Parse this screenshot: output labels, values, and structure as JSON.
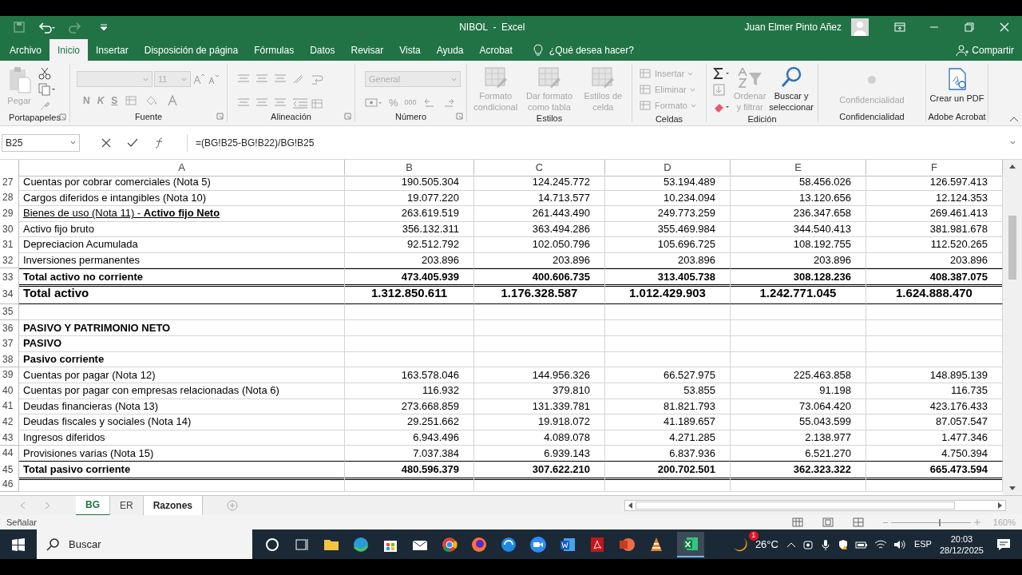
{
  "title_bar": {
    "title": "NIBOL  -  Excel",
    "user": "Juan Elmer Pinto Añez"
  },
  "tabs": [
    {
      "label": "Archivo",
      "selected": false
    },
    {
      "label": "Inicio",
      "selected": true
    },
    {
      "label": "Insertar",
      "selected": false
    },
    {
      "label": "Disposición de página",
      "selected": false
    },
    {
      "label": "Fórmulas",
      "selected": false
    },
    {
      "label": "Datos",
      "selected": false
    },
    {
      "label": "Revisar",
      "selected": false
    },
    {
      "label": "Vista",
      "selected": false
    },
    {
      "label": "Ayuda",
      "selected": false
    },
    {
      "label": "Acrobat",
      "selected": false
    }
  ],
  "tell_me": "¿Qué desea hacer?",
  "share": "Compartir",
  "ribbon": [
    {
      "kind": "clipboard",
      "label": "Portapapeles",
      "launcher": true,
      "items": [
        {
          "label": "Pegar",
          "disabled": true
        }
      ]
    },
    {
      "kind": "font",
      "label": "Fuente",
      "launcher": true,
      "size": "11",
      "items": [
        {
          "label": "N",
          "disabled": true
        },
        {
          "label": "K",
          "disabled": true
        },
        {
          "label": "S",
          "disabled": true
        }
      ]
    },
    {
      "kind": "alignment",
      "label": "Alineación",
      "launcher": true
    },
    {
      "kind": "number",
      "label": "Número",
      "launcher": true,
      "format": "General",
      "items": [
        {
          "label": "%",
          "disabled": true
        },
        {
          "label": "000",
          "disabled": true
        }
      ]
    },
    {
      "kind": "styles",
      "label": "Estilos",
      "launcher": false,
      "items": [
        {
          "label": "Formato condicional",
          "disabled": true
        },
        {
          "label": "Dar formato como tabla",
          "disabled": true
        },
        {
          "label": "Estilos de celda",
          "disabled": true
        }
      ]
    },
    {
      "kind": "cells",
      "label": "Celdas",
      "launcher": false,
      "items": [
        {
          "label": "Insertar",
          "disabled": true
        },
        {
          "label": "Eliminar",
          "disabled": true
        },
        {
          "label": "Formato",
          "disabled": true
        }
      ]
    },
    {
      "kind": "editing",
      "label": "Edición",
      "launcher": false,
      "items": [
        {
          "label": "Ordenar y filtrar",
          "disabled": true
        },
        {
          "label": "Buscar y seleccionar",
          "disabled": false
        }
      ]
    },
    {
      "kind": "sensitivity",
      "label": "Confidencialidad",
      "launcher": false,
      "items": [
        {
          "label": "Confidencialidad",
          "disabled": true
        }
      ]
    },
    {
      "kind": "acrobat",
      "label": "Adobe Acrobat",
      "launcher": false,
      "items": [
        {
          "label": "Crear un PDF",
          "disabled": false
        }
      ]
    }
  ],
  "formula_bar": {
    "name_box": "B25",
    "formula": "=(BG!B25-BG!B22)/BG!B25"
  },
  "columns": [
    "A",
    "B",
    "C",
    "D",
    "E",
    "F"
  ],
  "rows": [
    {
      "n": "27",
      "kind": "data",
      "cells": [
        "Cuentas por cobrar comerciales (Nota 5)",
        "190.505.304",
        "124.245.772",
        "53.194.489",
        "58.456.026",
        "126.597.413"
      ]
    },
    {
      "n": "28",
      "kind": "data",
      "cells": [
        "Cargos diferidos e intangibles (Nota 10)",
        "19.077.220",
        "14.713.577",
        "10.234.094",
        "13.120.656",
        "12.124.353"
      ]
    },
    {
      "n": "29",
      "kind": "data",
      "underline": true,
      "cells": [
        "Bienes de uso (Nota 11) - **Activo fijo Neto**",
        "263.619.519",
        "261.443.490",
        "249.773.259",
        "236.347.658",
        "269.461.413"
      ]
    },
    {
      "n": "30",
      "kind": "data",
      "cells": [
        "Activo fijo bruto",
        "356.132.311",
        "363.494.286",
        "355.469.984",
        "344.540.413",
        "381.981.678"
      ]
    },
    {
      "n": "31",
      "kind": "data",
      "cells": [
        "Depreciacion Acumulada",
        "92.512.792",
        "102.050.796",
        "105.696.725",
        "108.192.755",
        "112.520.265"
      ]
    },
    {
      "n": "32",
      "kind": "data",
      "cells": [
        "Inversiones permanentes",
        "203.896",
        "203.896",
        "203.896",
        "203.896",
        "203.896"
      ]
    },
    {
      "n": "33",
      "kind": "total",
      "cells": [
        "Total activo no corriente",
        "473.405.939",
        "400.606.735",
        "313.405.738",
        "308.128.236",
        "408.387.075"
      ]
    },
    {
      "n": "34",
      "kind": "grand",
      "cells": [
        "Total activo",
        "1.312.850.611",
        "1.176.328.587",
        "1.012.429.903",
        "1.242.771.045",
        "1.624.888.470"
      ]
    },
    {
      "n": "35",
      "kind": "empty",
      "cells": []
    },
    {
      "n": "36",
      "kind": "heading",
      "cells": [
        "PASIVO Y PATRIMONIO NETO"
      ]
    },
    {
      "n": "37",
      "kind": "heading",
      "cells": [
        "PASIVO"
      ]
    },
    {
      "n": "38",
      "kind": "heading",
      "cells": [
        "Pasivo corriente"
      ]
    },
    {
      "n": "39",
      "kind": "data",
      "cells": [
        "Cuentas por pagar (Nota 12)",
        "163.578.046",
        "144.956.326",
        "66.527.975",
        "225.463.858",
        "148.895.139"
      ]
    },
    {
      "n": "40",
      "kind": "data",
      "cells": [
        "Cuentas por pagar con empresas relacionadas (Nota 6)",
        "116.932",
        "379.810",
        "53.855",
        "91.198",
        "116.735"
      ]
    },
    {
      "n": "41",
      "kind": "data",
      "cells": [
        "Deudas financieras (Nota 13)",
        "273.668.859",
        "131.339.781",
        "81.821.793",
        "73.064.420",
        "423.176.433"
      ]
    },
    {
      "n": "42",
      "kind": "data",
      "cells": [
        "Deudas fiscales y sociales (Nota 14)",
        "29.251.662",
        "19.918.072",
        "41.189.657",
        "55.043.599",
        "87.057.547"
      ]
    },
    {
      "n": "43",
      "kind": "data",
      "cells": [
        "Ingresos diferidos",
        "6.943.496",
        "4.089.078",
        "4.271.285",
        "2.138.977",
        "1.477.346"
      ]
    },
    {
      "n": "44",
      "kind": "data",
      "cells": [
        "Provisiones varias (Nota 15)",
        "7.037.384",
        "6.939.143",
        "6.837.936",
        "6.521.270",
        "4.750.394"
      ]
    },
    {
      "n": "45",
      "kind": "total",
      "cells": [
        "Total pasivo corriente",
        "480.596.379",
        "307.622.210",
        "200.702.501",
        "362.323.322",
        "665.473.594"
      ]
    },
    {
      "n": "46",
      "kind": "empty",
      "cells": []
    }
  ],
  "sheet_tabs": [
    {
      "label": "BG",
      "selected": true,
      "bold": true
    },
    {
      "label": "ER",
      "selected": false,
      "bold": false
    },
    {
      "label": "Razones",
      "selected": false,
      "bold": true
    }
  ],
  "status_bar": {
    "mode": "Señalar",
    "zoom": {
      "level": 0.6,
      "reading": "160%"
    }
  },
  "taskbar": {
    "search": "Buscar",
    "weather_badge": "1",
    "temperature": "26°C",
    "language": "ESP",
    "time": "20:03",
    "date": "28/12/2025"
  }
}
